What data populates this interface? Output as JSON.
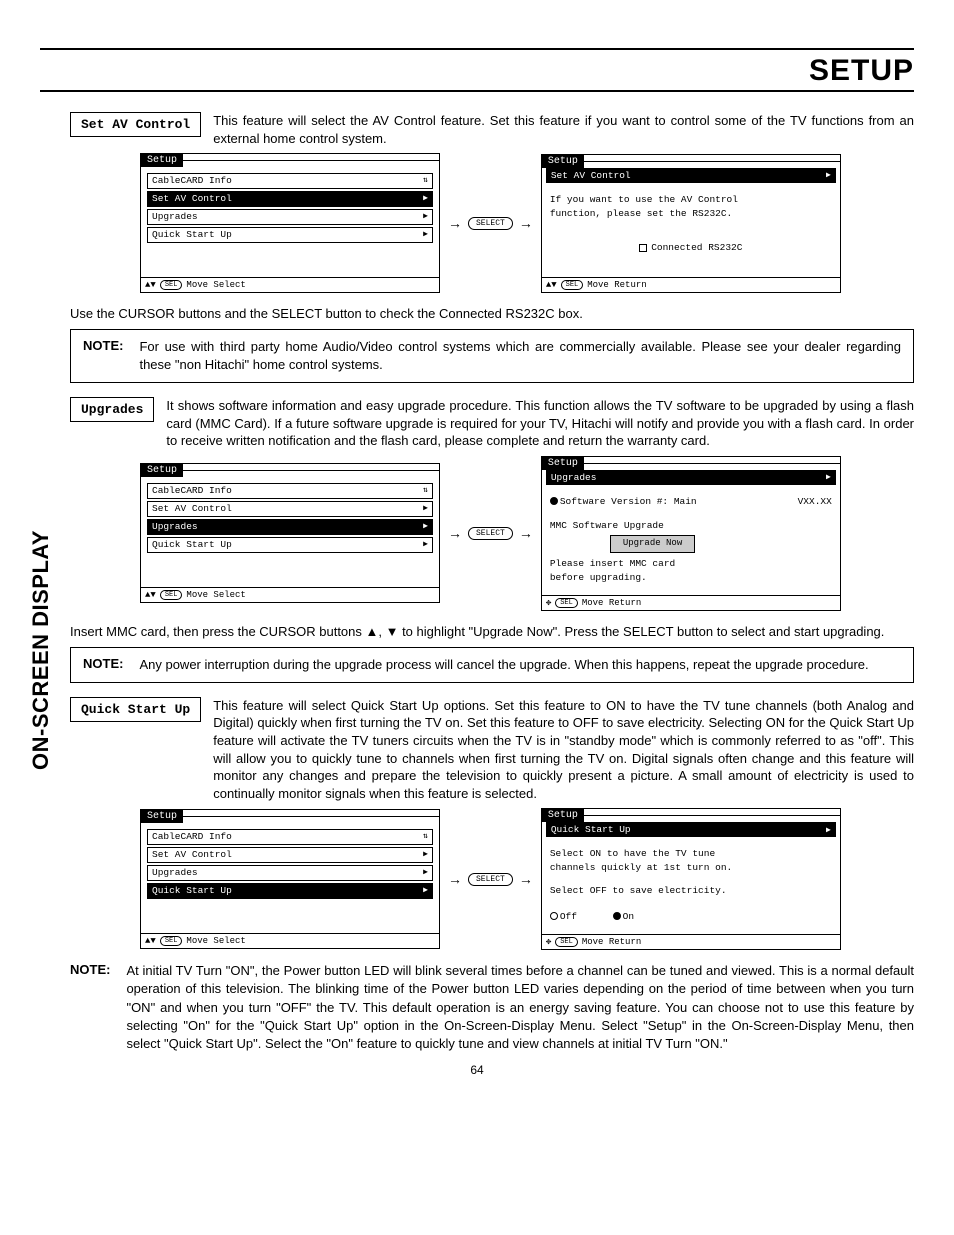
{
  "title": "SETUP",
  "sidebar": "ON-SCREEN DISPLAY",
  "page_number": "64",
  "instruction_rs232c": "Use the CURSOR buttons and the SELECT button to check the Connected RS232C box.",
  "instruction_mmc": "Insert MMC card, then press the CURSOR buttons ▲, ▼ to highlight \"Upgrade Now\".  Press the SELECT button to select and start upgrading.",
  "sections": {
    "av": {
      "label": "Set AV Control",
      "desc": "This feature will select the AV Control feature.  Set this feature if you want to control some of the TV functions from an external home control system."
    },
    "upgrades": {
      "label": "Upgrades",
      "desc": "It shows software information and easy upgrade procedure.  This function allows the TV software to be upgraded by using a flash card (MMC Card).  If a future software upgrade is required for your TV, Hitachi will notify and provide you with a flash card.  In order to receive written notification and the flash card, please complete and return the warranty card."
    },
    "quick": {
      "label": "Quick Start Up",
      "desc": "This feature will select Quick Start Up options.  Set this feature to ON to have the TV tune channels (both Analog and Digital) quickly when first turning the TV on.  Set this feature to OFF to save electricity.  Selecting ON for the Quick Start Up feature will activate the TV tuners circuits when the TV is in \"standby mode\" which is commonly referred to as \"off\".  This will allow you to quickly tune to channels when first turning the TV on.  Digital signals often change and this feature will monitor any changes and prepare the television to quickly present a picture.  A small amount of electricity is used to continually monitor signals when this feature is selected."
    }
  },
  "notes": {
    "n1": {
      "label": "NOTE:",
      "text": "For use with third party home Audio/Video control systems which are commercially available.  Please see your dealer regarding these \"non Hitachi\" home control systems."
    },
    "n2": {
      "label": "NOTE:",
      "text": "Any power interruption during the upgrade process will cancel the upgrade.  When this happens, repeat the upgrade procedure."
    },
    "n3": {
      "label": "NOTE:",
      "text": "At initial TV Turn \"ON\", the Power button LED will blink several times before a channel can be tuned and viewed. This is a normal default operation of this television. The blinking time of the Power button LED varies depending on the period of time between when you turn \"ON\" and when you turn \"OFF\" the TV. This default operation is an energy saving feature. You can choose not to use this feature by selecting \"On\" for the \"Quick Start Up\" option in the On-Screen-Display Menu. Select \"Setup\" in the On-Screen-Display Menu, then select \"Quick Start Up\". Select the \"On\" feature to quickly tune and view channels at initial TV Turn \"ON.\""
    }
  },
  "menu": {
    "setup": "Setup",
    "cablecard": "CableCARD Info",
    "set_av": "Set AV Control",
    "upgrades": "Upgrades",
    "quick": "Quick Start Up",
    "foot_select": "Move      Select",
    "foot_return": "Move      Return",
    "select_btn": "SELECT",
    "sel_small": "SEL",
    "arrows_v": "▲▼",
    "arrows_all": "✥"
  },
  "av_detail": {
    "line1": "If you want to use the AV Control",
    "line2": "function, please set the RS232C.",
    "check": "Connected RS232C"
  },
  "upg_detail": {
    "sw_line": "Software Version #: Main",
    "sw_ver": "VXX.XX",
    "mmc": "MMC Software Upgrade",
    "btn": "Upgrade Now",
    "p1": "Please insert MMC card",
    "p2": "before upgrading."
  },
  "quick_detail": {
    "l1": "Select ON to have the TV tune",
    "l2": "channels quickly at 1st turn on.",
    "l3": "Select OFF to save electricity.",
    "off": "Off",
    "on": "On"
  }
}
